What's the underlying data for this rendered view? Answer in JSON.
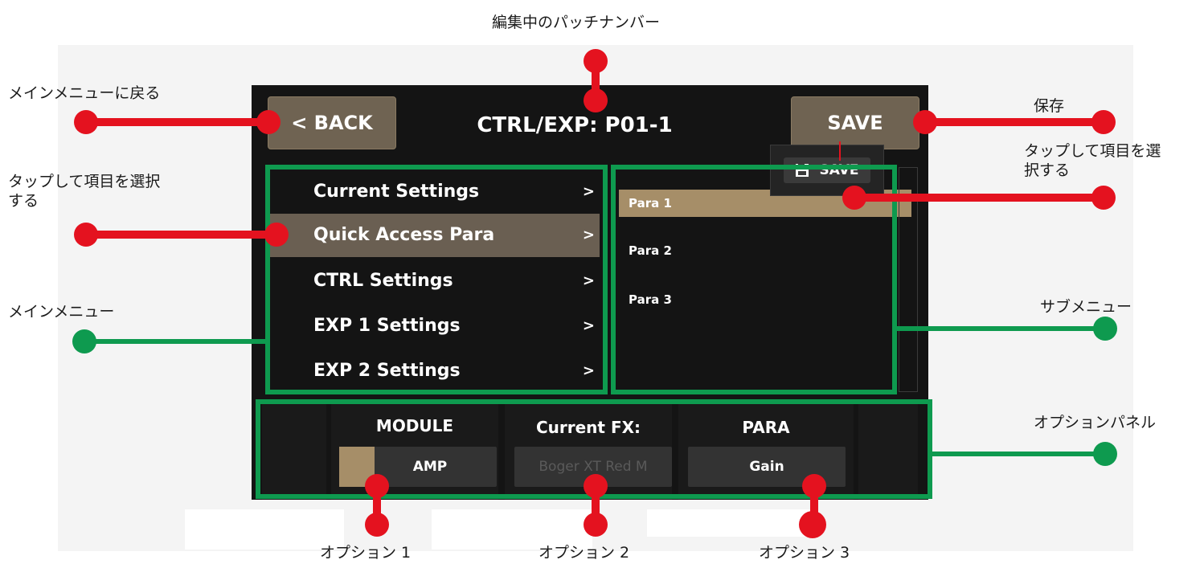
{
  "annotations": {
    "patch_number": "編集中のパッチナンバー",
    "back_to_main": "メインメニューに戻る",
    "tap_select_left": "タップして項目を選択\nする",
    "main_menu": "メインメニュー",
    "save": "保存",
    "tap_select_right": "タップして項目を選\n択する",
    "sub_menu": "サブメニュー",
    "option_panel": "オプションパネル",
    "option1": "オプション 1",
    "option2": "オプション  2",
    "option3": "オプション  3"
  },
  "screen": {
    "back_label": "< BACK",
    "title": "CTRL/EXP: P01-1",
    "save_label": "SAVE",
    "save_popup_label": "SAVE",
    "main_menu": {
      "items": [
        {
          "label": "Current Settings",
          "chevron": ">"
        },
        {
          "label": "Quick Access Para",
          "chevron": ">"
        },
        {
          "label": "CTRL Settings",
          "chevron": ">"
        },
        {
          "label": "EXP 1 Settings",
          "chevron": ">"
        },
        {
          "label": "EXP 2 Settings",
          "chevron": ">"
        }
      ],
      "selected": "Quick Access Para"
    },
    "sub_menu": {
      "items": [
        {
          "label": "Para 1"
        },
        {
          "label": "Para 2"
        },
        {
          "label": "Para 3"
        }
      ],
      "selected": "Para 1"
    },
    "options": [
      {
        "header": "MODULE",
        "value": "AMP"
      },
      {
        "header": "Current FX:",
        "value": "Boger XT Red M"
      },
      {
        "header": "PARA",
        "value": "Gain"
      }
    ]
  },
  "colors": {
    "screen_bg": "#141414",
    "button_bg": "#6f6352",
    "selected_menu": "#6a5f52",
    "selected_sub": "#a68e68",
    "callout_red": "#e4121f",
    "callout_green": "#0e9a4f"
  },
  "icons": {
    "save_popup_icon": "floppy-disk-icon"
  }
}
